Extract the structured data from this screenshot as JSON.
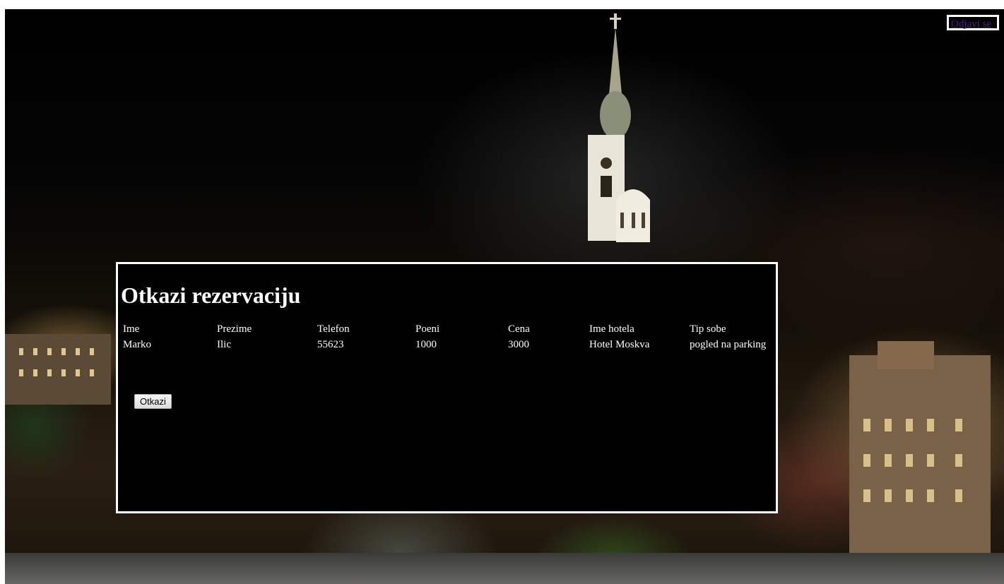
{
  "header": {
    "logout_label": "Odjavi se"
  },
  "dialog": {
    "title": "Otkazi rezervaciju",
    "columns": [
      "Ime",
      "Prezime",
      "Telefon",
      "Poeni",
      "Cena",
      "Ime hotela",
      "Tip sobe"
    ],
    "row": [
      "Marko",
      "Ilic",
      "55623",
      "1000",
      "3000",
      "Hotel Moskva",
      "pogled na parking"
    ],
    "cancel_button_label": "Otkazi"
  },
  "colors": {
    "panel_background": "#000000",
    "panel_border": "#ffffff",
    "text": "#ffffff",
    "link": "#551a8b"
  }
}
